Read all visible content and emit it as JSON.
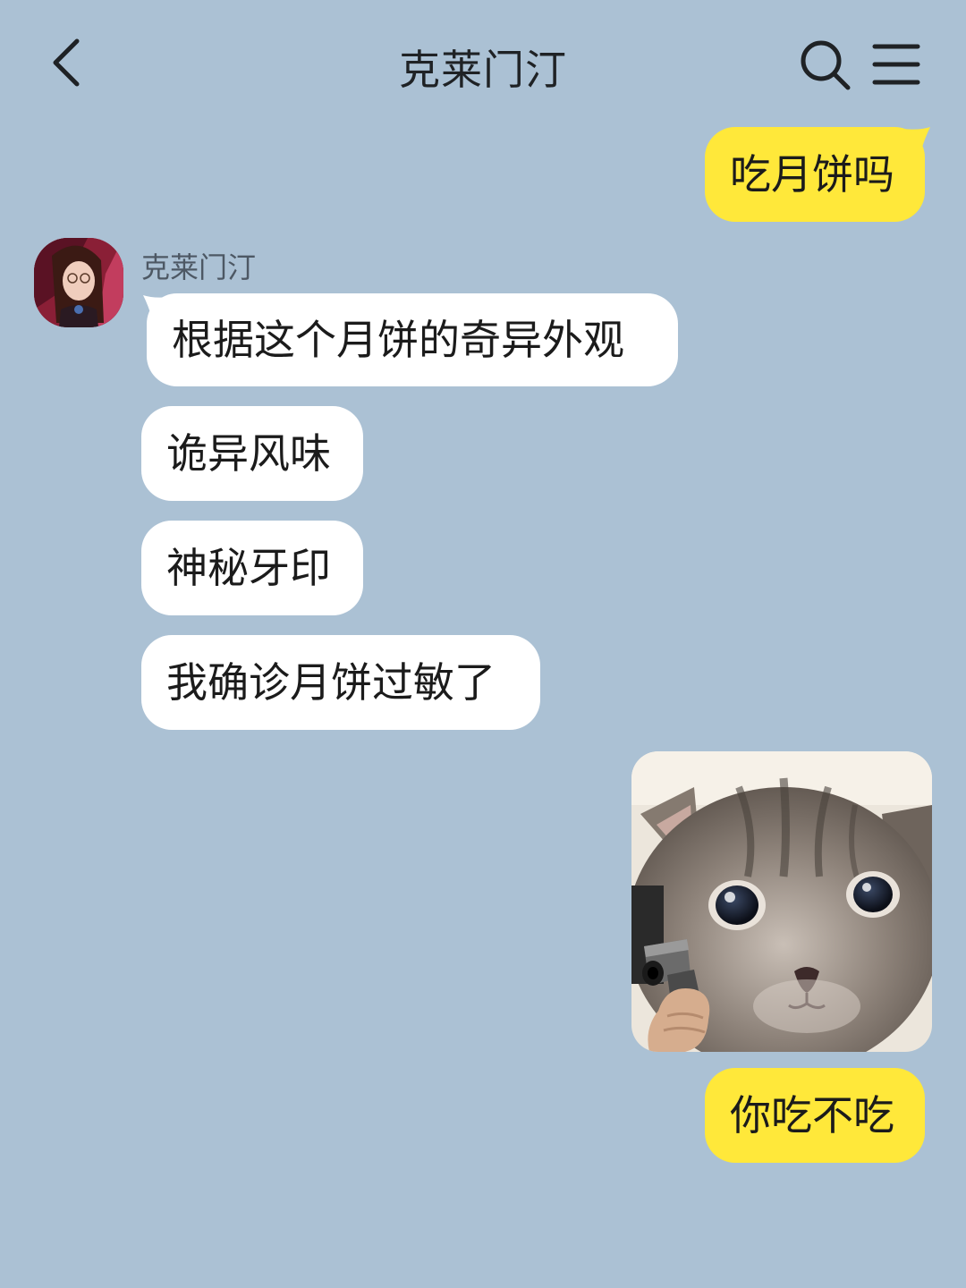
{
  "header": {
    "title": "克莱门汀"
  },
  "contact": {
    "name": "克莱门汀"
  },
  "messages": [
    {
      "from": "me",
      "text": "吃月饼吗"
    },
    {
      "from": "other",
      "text": "根据这个月饼的奇异外观"
    },
    {
      "from": "other",
      "text": "诡异风味"
    },
    {
      "from": "other",
      "text": "神秘牙印"
    },
    {
      "from": "other",
      "text": "我确诊月饼过敏了"
    },
    {
      "from": "me",
      "type": "sticker",
      "sticker": "kitten-with-gun"
    },
    {
      "from": "me",
      "text": "你吃不吃"
    }
  ],
  "icons": {
    "back": "chevron-left-icon",
    "search": "search-icon",
    "menu": "hamburger-menu-icon"
  },
  "colors": {
    "background": "#abc1d4",
    "my_bubble": "#ffe83a",
    "their_bubble": "#ffffff"
  }
}
